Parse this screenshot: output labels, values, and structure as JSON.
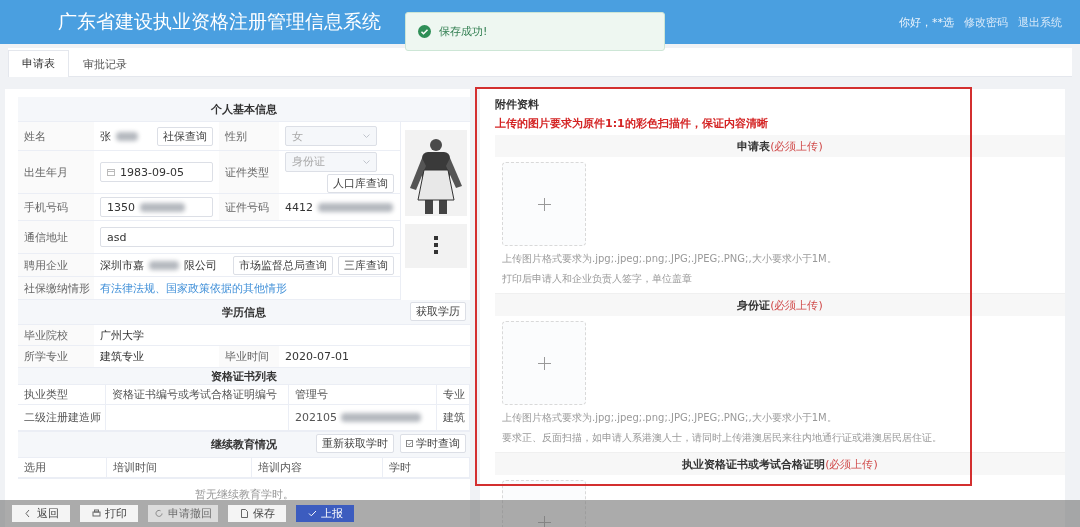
{
  "header": {
    "title": "广东省建设执业资格注册管理信息系统",
    "greeting": "你好，**选",
    "links": [
      "修改密码",
      "退出系统"
    ]
  },
  "toast": {
    "kind": "success",
    "message": "保存成功!"
  },
  "tabs": [
    {
      "label": "申请表",
      "selected": true
    },
    {
      "label": "审批记录",
      "selected": false
    }
  ],
  "personal_info": {
    "title": "个人基本信息",
    "rows": [
      {
        "cells": [
          {
            "label": "姓名",
            "kind": "text",
            "value": "张",
            "redacted": true,
            "buttons": [
              "社保查询"
            ]
          },
          {
            "label": "性别",
            "kind": "select",
            "value": "女",
            "disabled": true
          }
        ]
      },
      {
        "cells": [
          {
            "label": "出生年月",
            "kind": "date",
            "value": "1983-09-05"
          },
          {
            "label": "证件类型",
            "kind": "select",
            "value": "身份证",
            "disabled": true,
            "buttons": [
              "人口库查询"
            ]
          }
        ]
      },
      {
        "cells": [
          {
            "label": "手机号码",
            "kind": "input",
            "value": "1350",
            "redacted": true
          },
          {
            "label": "证件号码",
            "kind": "text",
            "value": "4412",
            "redacted": true
          }
        ]
      },
      {
        "cells": [
          {
            "label": "通信地址",
            "kind": "input",
            "value": "asd"
          }
        ]
      },
      {
        "cells": [
          {
            "label": "聘用企业",
            "kind": "text",
            "value": "深圳市嘉",
            "redacted": true,
            "value_end": "限公司",
            "buttons": [
              "市场监督总局查询",
              "三库查询"
            ]
          }
        ]
      },
      {
        "cells": [
          {
            "label": "社保缴纳情形",
            "kind": "link",
            "value": "有法律法规、国家政策依据的其他情形"
          }
        ]
      }
    ]
  },
  "education": {
    "title": "学历信息",
    "buttons": [
      "获取学历"
    ],
    "rows": [
      {
        "cells": [
          {
            "label": "毕业院校",
            "kind": "text",
            "value": "广州大学"
          }
        ]
      },
      {
        "cells": [
          {
            "label": "所学专业",
            "kind": "text",
            "value": "建筑专业"
          },
          {
            "label": "毕业时间",
            "kind": "text",
            "value": "2020-07-01"
          }
        ]
      }
    ]
  },
  "certificates": {
    "title": "资格证书列表",
    "columns": [
      "执业类型",
      "资格证书编号或考试合格证明编号",
      "管理号",
      "专业"
    ],
    "rows": [
      {
        "type": "二级注册建造师",
        "management_no": "202105",
        "redacted": true,
        "major": "建筑"
      }
    ]
  },
  "continuing_education": {
    "title": "继续教育情况",
    "buttons": [
      {
        "label": "重新获取学时",
        "kind": "plain"
      },
      {
        "label": "学时查询",
        "kind": "query"
      }
    ],
    "columns": [
      "选用",
      "培训时间",
      "培训内容",
      "学时"
    ],
    "empty_text": "暂无继续教育学时。"
  },
  "attachments": {
    "title": "附件资料",
    "highlighted": true,
    "notice": "上传的图片要求为原件1:1的彩色扫描件，保证内容清晰",
    "sections": [
      {
        "title": "申请表",
        "required": "(必须上传)",
        "hints": [
          "上传图片格式要求为.jpg;.jpeg;.png;.JPG;.JPEG;.PNG;,大小要求小于1M。",
          "打印后申请人和企业负责人签字，单位盖章"
        ]
      },
      {
        "title": "身份证",
        "required": "(必须上传)",
        "hints": [
          "上传图片格式要求为.jpg;.jpeg;.png;.JPG;.JPEG;.PNG;,大小要求小于1M。",
          "要求正、反面扫描，如申请人系港澳人士，请同时上传港澳居民来往内地通行证或港澳居民居住证。"
        ]
      },
      {
        "title": "执业资格证书或考试合格证明",
        "required": "(必须上传)"
      }
    ]
  },
  "actions": [
    {
      "label": "返回",
      "kind": "back",
      "disabled": false
    },
    {
      "label": "打印",
      "kind": "print",
      "disabled": false
    },
    {
      "label": "申请撤回",
      "kind": "withdraw",
      "disabled": true
    },
    {
      "label": "保存",
      "kind": "save",
      "disabled": false
    },
    {
      "label": "上报",
      "kind": "submit",
      "disabled": false
    }
  ]
}
